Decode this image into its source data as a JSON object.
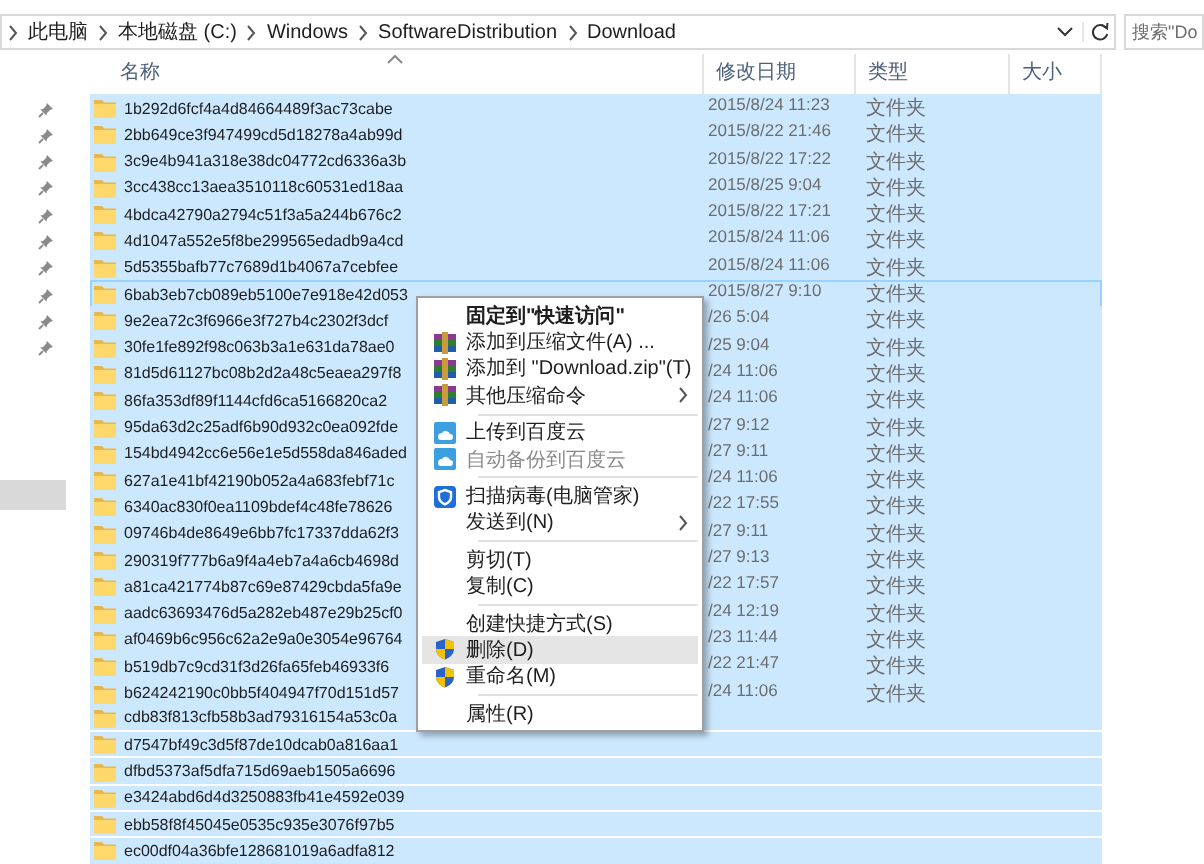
{
  "address_bar": {
    "path": [
      "此电脑",
      "本地磁盘 (C:)",
      "Windows",
      "SoftwareDistribution",
      "Download"
    ]
  },
  "search": {
    "placeholder": "搜索\"Do"
  },
  "columns": [
    "名称",
    "修改日期",
    "类型",
    "大小"
  ],
  "rows": [
    {
      "name": "1b292d6fcf4a4d84664489f3ac73cabe",
      "date": "2015/8/24 11:23",
      "type": "文件夹",
      "selected": true,
      "focused": false
    },
    {
      "name": "2bb649ce3f947499cd5d18278a4ab99d",
      "date": "2015/8/22 21:46",
      "type": "文件夹",
      "selected": true,
      "focused": false
    },
    {
      "name": "3c9e4b941a318e38dc04772cd6336a3b",
      "date": "2015/8/22 17:22",
      "type": "文件夹",
      "selected": true,
      "focused": false
    },
    {
      "name": "3cc438cc13aea3510118c60531ed18aa",
      "date": "2015/8/25 9:04",
      "type": "文件夹",
      "selected": true,
      "focused": false
    },
    {
      "name": "4bdca42790a2794c51f3a5a244b676c2",
      "date": "2015/8/22 17:21",
      "type": "文件夹",
      "selected": true,
      "focused": false
    },
    {
      "name": "4d1047a552e5f8be299565edadb9a4cd",
      "date": "2015/8/24 11:06",
      "type": "文件夹",
      "selected": true,
      "focused": false
    },
    {
      "name": "5d5355bafb77c7689d1b4067a7cebfee",
      "date": "2015/8/24 11:06",
      "type": "文件夹",
      "selected": true,
      "focused": false
    },
    {
      "name": "6bab3eb7cb089eb5100e7e918e42d053",
      "date": "2015/8/27 9:10",
      "type": "文件夹",
      "selected": true,
      "focused": true
    },
    {
      "name": "9e2ea72c3f6966e3f727b4c2302f3dcf",
      "date": "/26 5:04",
      "type": "文件夹",
      "selected": true,
      "focused": false
    },
    {
      "name": "30fe1fe892f98c063b3a1e631da78ae0",
      "date": "/25 9:04",
      "type": "文件夹",
      "selected": true,
      "focused": false
    },
    {
      "name": "81d5d61127bc08b2d2a48c5eaea297f8",
      "date": "/24 11:06",
      "type": "文件夹",
      "selected": true,
      "focused": false
    },
    {
      "name": "86fa353df89f1144cfd6ca5166820ca2",
      "date": "/24 11:06",
      "type": "文件夹",
      "selected": true,
      "focused": false
    },
    {
      "name": "95da63d2c25adf6b90d932c0ea092fde",
      "date": "/27 9:12",
      "type": "文件夹",
      "selected": true,
      "focused": false
    },
    {
      "name": "154bd4942cc6e56e1e5d558da846aded",
      "date": "/27 9:11",
      "type": "文件夹",
      "selected": true,
      "focused": false
    },
    {
      "name": "627a1e41bf42190b052a4a683febf71c",
      "date": "/24 11:06",
      "type": "文件夹",
      "selected": true,
      "focused": false
    },
    {
      "name": "6340ac830f0ea1109bdef4c48fe78626",
      "date": "/22 17:55",
      "type": "文件夹",
      "selected": true,
      "focused": false
    },
    {
      "name": "09746b4de8649e6bb7fc17337dda62f3",
      "date": "/27 9:11",
      "type": "文件夹",
      "selected": true,
      "focused": false
    },
    {
      "name": "290319f777b6a9f4a4eb7a4a6cb4698d",
      "date": "/27 9:13",
      "type": "文件夹",
      "selected": true,
      "focused": false
    },
    {
      "name": "a81ca421774b87c69e87429cbda5fa9e",
      "date": "/22 17:57",
      "type": "文件夹",
      "selected": true,
      "focused": false
    },
    {
      "name": "aadc63693476d5a282eb487e29b25cf0",
      "date": "/24 12:19",
      "type": "文件夹",
      "selected": true,
      "focused": false
    },
    {
      "name": "af0469b6c956c62a2e9a0e3054e96764",
      "date": "/23 11:44",
      "type": "文件夹",
      "selected": true,
      "focused": false
    },
    {
      "name": "b519db7c9cd31f3d26fa65feb46933f6",
      "date": "/22 21:47",
      "type": "文件夹",
      "selected": true,
      "focused": false
    },
    {
      "name": "b624242190c0bb5f404947f70d151d57",
      "date": "/24 11:06",
      "type": "文件夹",
      "selected": true,
      "focused": false
    },
    {
      "name": "cdb83f813cfb58b3ad79316154a53c0a",
      "selected": true,
      "focused": false
    },
    {
      "name": "d7547bf49c3d5f87de10dcab0a816aa1",
      "selected": true,
      "focused": false
    },
    {
      "name": "dfbd5373af5dfa715d69aeb1505a6696",
      "selected": true,
      "focused": false
    },
    {
      "name": "e3424abd6d4d3250883fb41e4592e039",
      "selected": true,
      "focused": false
    },
    {
      "name": "ebb58f8f45045e0535c935e3076f97b5",
      "selected": true,
      "focused": false
    },
    {
      "name": "ec00df04a36bfe128681019a6adfa812",
      "selected": true,
      "focused": false
    }
  ],
  "context_menu": {
    "items": [
      {
        "kind": "plain",
        "label": "固定到\"快速访问\"",
        "bold": true,
        "selected": false,
        "disabled": false
      },
      {
        "kind": "archive",
        "label": "添加到压缩文件(A) ...",
        "bold": false,
        "selected": false,
        "disabled": false
      },
      {
        "kind": "archive",
        "label": "添加到 \"Download.zip\"(T)",
        "bold": false,
        "selected": false,
        "disabled": false
      },
      {
        "kind": "archive",
        "label": "其他压缩命令",
        "bold": false,
        "selected": false,
        "disabled": false,
        "submenu": true
      },
      {
        "kind": "separator"
      },
      {
        "kind": "cloud",
        "label": "上传到百度云",
        "bold": false,
        "selected": false,
        "disabled": false
      },
      {
        "kind": "cloud",
        "label": "自动备份到百度云",
        "bold": false,
        "selected": false,
        "disabled": true
      },
      {
        "kind": "separator"
      },
      {
        "kind": "antivirus",
        "label": "扫描病毒(电脑管家)",
        "bold": false,
        "selected": false,
        "disabled": false
      },
      {
        "kind": "plain",
        "label": "发送到(N)",
        "bold": false,
        "selected": false,
        "disabled": false,
        "submenu": true
      },
      {
        "kind": "separator"
      },
      {
        "kind": "plain",
        "label": "剪切(T)",
        "bold": false,
        "selected": false,
        "disabled": false
      },
      {
        "kind": "plain",
        "label": "复制(C)",
        "bold": false,
        "selected": false,
        "disabled": false
      },
      {
        "kind": "separator"
      },
      {
        "kind": "plain",
        "label": "创建快捷方式(S)",
        "bold": false,
        "selected": false,
        "disabled": false
      },
      {
        "kind": "admin",
        "label": "删除(D)",
        "bold": false,
        "selected": true,
        "disabled": false
      },
      {
        "kind": "admin",
        "label": "重命名(M)",
        "bold": false,
        "selected": false,
        "disabled": false
      },
      {
        "kind": "separator"
      },
      {
        "kind": "plain",
        "label": "属性(R)",
        "bold": false,
        "selected": false,
        "disabled": false
      }
    ]
  }
}
